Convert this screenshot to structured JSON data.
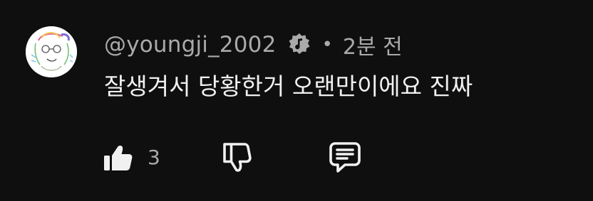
{
  "comment": {
    "author_handle": "@youngji_2002",
    "badge_icon": "music-note-badge-icon",
    "separator": "•",
    "timestamp": "2분 전",
    "text": "잘생겨서 당황한거 오랜만이에요 진짜"
  },
  "actions": {
    "like_icon": "thumbs-up-icon",
    "like_count": "3",
    "dislike_icon": "thumbs-down-icon",
    "reply_icon": "reply-message-icon"
  },
  "colors": {
    "background": "#0f0f0f",
    "primary_text": "#f1f1f1",
    "secondary_text": "#aaaaaa"
  }
}
